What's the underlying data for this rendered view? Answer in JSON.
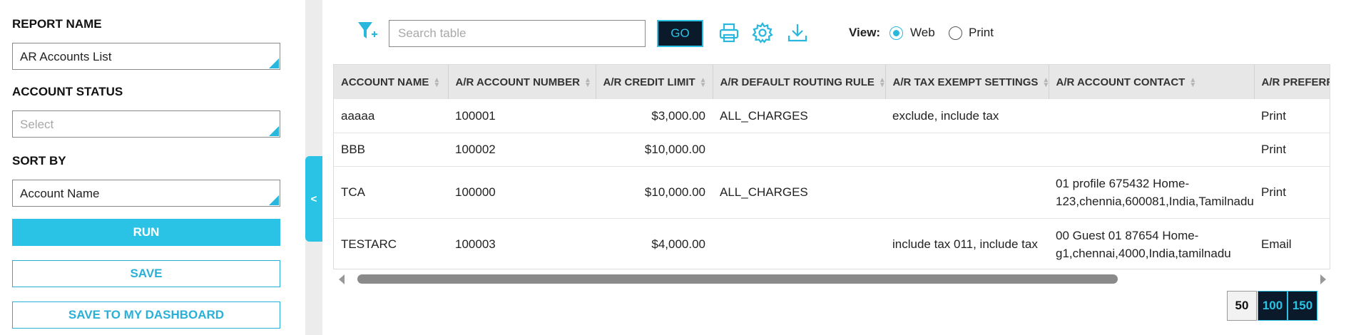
{
  "sidebar": {
    "report_name_label": "REPORT NAME",
    "report_name_value": "AR Accounts List",
    "account_status_label": "ACCOUNT STATUS",
    "account_status_placeholder": "Select",
    "sort_by_label": "SORT BY",
    "sort_by_value": "Account Name",
    "run_label": "RUN",
    "save_label": "SAVE",
    "save_dashboard_label": "SAVE TO MY DASHBOARD",
    "collapse_glyph": "<"
  },
  "toolbar": {
    "search_placeholder": "Search table",
    "go_label": "GO",
    "view_label": "View:",
    "view_options": [
      "Web",
      "Print"
    ],
    "view_selected": "Web",
    "icons": [
      "filter-add-icon",
      "printer-icon",
      "gear-icon",
      "download-icon"
    ]
  },
  "table": {
    "columns": [
      "ACCOUNT NAME",
      "A/R ACCOUNT NUMBER",
      "A/R CREDIT LIMIT",
      "A/R DEFAULT ROUTING RULE",
      "A/R TAX EXEMPT SETTINGS",
      "A/R ACCOUNT CONTACT",
      "A/R PREFERRE"
    ],
    "rows": [
      {
        "name": "aaaaa",
        "number": "100001",
        "limit": "$3,000.00",
        "routing": "ALL_CHARGES",
        "tax": "exclude, include tax",
        "contact": "",
        "preferred": "Print"
      },
      {
        "name": "BBB",
        "number": "100002",
        "limit": "$10,000.00",
        "routing": "",
        "tax": "",
        "contact": "",
        "preferred": "Print"
      },
      {
        "name": "TCA",
        "number": "100000",
        "limit": "$10,000.00",
        "routing": "ALL_CHARGES",
        "tax": "",
        "contact": "01 profile 675432 Home-123,chennia,600081,India,Tamilnadu",
        "preferred": "Print"
      },
      {
        "name": "TESTARC",
        "number": "100003",
        "limit": "$4,000.00",
        "routing": "",
        "tax": "include tax 011, include tax",
        "contact": "00 Guest 01 87654 Home-g1,chennai,4000,India,tamilnadu",
        "preferred": "Email"
      }
    ]
  },
  "pagination": {
    "sizes": [
      "50",
      "100",
      "150"
    ],
    "selected": "50"
  },
  "colors": {
    "accent": "#2ac3e5",
    "dark": "#0a1a2a"
  }
}
